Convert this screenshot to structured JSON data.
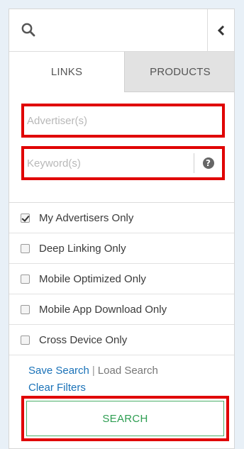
{
  "panel": {
    "collapse_glyph": "‹"
  },
  "tabs": [
    {
      "label": "LINKS",
      "active": true
    },
    {
      "label": "PRODUCTS",
      "active": false
    }
  ],
  "fields": {
    "advertiser": {
      "placeholder": "Advertiser(s)",
      "value": ""
    },
    "keyword": {
      "placeholder": "Keyword(s)",
      "value": "",
      "help_glyph": "?"
    }
  },
  "options": [
    {
      "label": "My Advertisers Only",
      "checked": true
    },
    {
      "label": "Deep Linking Only",
      "checked": false
    },
    {
      "label": "Mobile Optimized Only",
      "checked": false
    },
    {
      "label": "Mobile App Download Only",
      "checked": false
    },
    {
      "label": "Cross Device Only",
      "checked": false
    }
  ],
  "actions": {
    "save_search": "Save Search",
    "separator": "|",
    "load_search": "Load Search",
    "clear_filters": "Clear Filters",
    "search_button": "SEARCH"
  },
  "colors": {
    "highlight": "#e00000",
    "link": "#1a72b8",
    "search_text": "#2e9e52"
  },
  "icons": [
    "search-icon",
    "chevron-left-icon",
    "help-icon",
    "checkbox-icon"
  ]
}
